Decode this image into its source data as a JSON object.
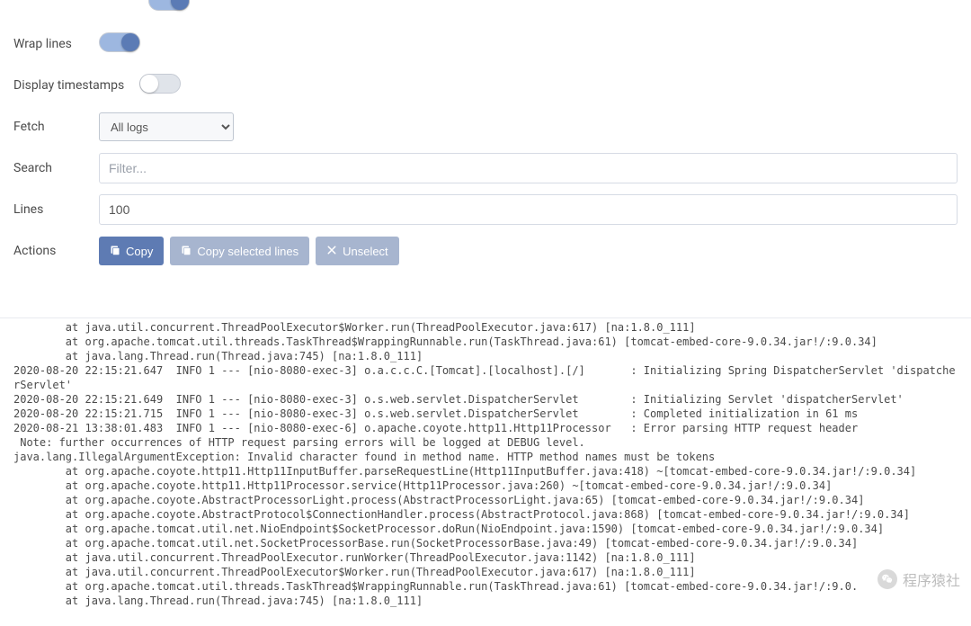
{
  "controls": {
    "toggle_top": {
      "label": "",
      "on": true
    },
    "wrap_lines": {
      "label": "Wrap lines",
      "on": true
    },
    "display_timestamps": {
      "label": "Display timestamps",
      "on": false
    },
    "fetch": {
      "label": "Fetch",
      "selected": "All logs"
    },
    "search": {
      "label": "Search",
      "placeholder": "Filter...",
      "value": ""
    },
    "lines": {
      "label": "Lines",
      "value": "100"
    },
    "actions": {
      "label": "Actions",
      "copy": "Copy",
      "copy_selected": "Copy selected lines",
      "unselect": "Unselect"
    }
  },
  "log_lines": [
    "        at java.util.concurrent.ThreadPoolExecutor$Worker.run(ThreadPoolExecutor.java:617) [na:1.8.0_111]",
    "        at org.apache.tomcat.util.threads.TaskThread$WrappingRunnable.run(TaskThread.java:61) [tomcat-embed-core-9.0.34.jar!/:9.0.34]",
    "        at java.lang.Thread.run(Thread.java:745) [na:1.8.0_111]",
    "2020-08-20 22:15:21.647  INFO 1 --- [nio-8080-exec-3] o.a.c.c.C.[Tomcat].[localhost].[/]       : Initializing Spring DispatcherServlet 'dispatcherServlet'",
    "2020-08-20 22:15:21.649  INFO 1 --- [nio-8080-exec-3] o.s.web.servlet.DispatcherServlet        : Initializing Servlet 'dispatcherServlet'",
    "2020-08-20 22:15:21.715  INFO 1 --- [nio-8080-exec-3] o.s.web.servlet.DispatcherServlet        : Completed initialization in 61 ms",
    "2020-08-21 13:38:01.483  INFO 1 --- [nio-8080-exec-6] o.apache.coyote.http11.Http11Processor   : Error parsing HTTP request header",
    " Note: further occurrences of HTTP request parsing errors will be logged at DEBUG level.",
    "java.lang.IllegalArgumentException: Invalid character found in method name. HTTP method names must be tokens",
    "        at org.apache.coyote.http11.Http11InputBuffer.parseRequestLine(Http11InputBuffer.java:418) ~[tomcat-embed-core-9.0.34.jar!/:9.0.34]",
    "        at org.apache.coyote.http11.Http11Processor.service(Http11Processor.java:260) ~[tomcat-embed-core-9.0.34.jar!/:9.0.34]",
    "        at org.apache.coyote.AbstractProcessorLight.process(AbstractProcessorLight.java:65) [tomcat-embed-core-9.0.34.jar!/:9.0.34]",
    "        at org.apache.coyote.AbstractProtocol$ConnectionHandler.process(AbstractProtocol.java:868) [tomcat-embed-core-9.0.34.jar!/:9.0.34]",
    "        at org.apache.tomcat.util.net.NioEndpoint$SocketProcessor.doRun(NioEndpoint.java:1590) [tomcat-embed-core-9.0.34.jar!/:9.0.34]",
    "        at org.apache.tomcat.util.net.SocketProcessorBase.run(SocketProcessorBase.java:49) [tomcat-embed-core-9.0.34.jar!/:9.0.34]",
    "        at java.util.concurrent.ThreadPoolExecutor.runWorker(ThreadPoolExecutor.java:1142) [na:1.8.0_111]",
    "        at java.util.concurrent.ThreadPoolExecutor$Worker.run(ThreadPoolExecutor.java:617) [na:1.8.0_111]",
    "        at org.apache.tomcat.util.threads.TaskThread$WrappingRunnable.run(TaskThread.java:61) [tomcat-embed-core-9.0.34.jar!/:9.0.",
    "        at java.lang.Thread.run(Thread.java:745) [na:1.8.0_111]"
  ],
  "watermark": {
    "text": "程序猿社"
  }
}
